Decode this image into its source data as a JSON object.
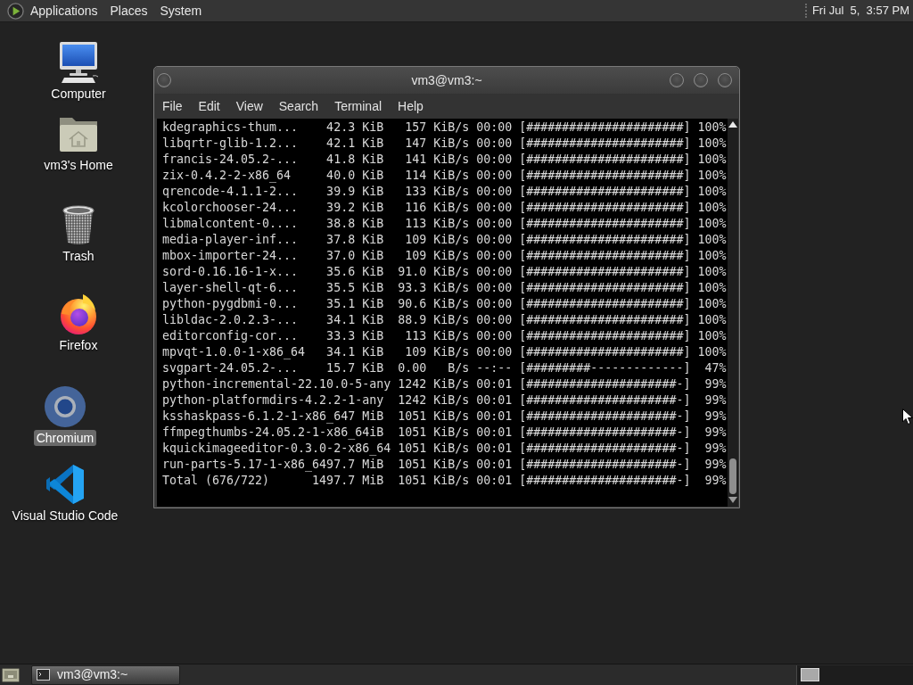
{
  "top_panel": {
    "menus": [
      "Applications",
      "Places",
      "System"
    ],
    "clock": "Fri Jul  5,  3:57 PM"
  },
  "desktop_icons": [
    {
      "label": "Computer",
      "kind": "computer",
      "selected": false
    },
    {
      "label": "vm3's Home",
      "kind": "home",
      "selected": false
    },
    {
      "label": "Trash",
      "kind": "trash",
      "selected": false
    },
    {
      "label": "Firefox",
      "kind": "firefox",
      "selected": false
    },
    {
      "label": "Chromium",
      "kind": "chromium",
      "selected": true
    },
    {
      "label": "Visual Studio Code",
      "kind": "vscode",
      "selected": false
    }
  ],
  "terminal_window": {
    "title": "vm3@vm3:~",
    "menu": [
      "File",
      "Edit",
      "View",
      "Search",
      "Terminal",
      "Help"
    ],
    "lines": [
      "kdegraphics-thum...    42.3 KiB   157 KiB/s 00:00 [######################] 100%",
      "libqrtr-glib-1.2...    42.1 KiB   147 KiB/s 00:00 [######################] 100%",
      "francis-24.05.2-...    41.8 KiB   141 KiB/s 00:00 [######################] 100%",
      "zix-0.4.2-2-x86_64     40.0 KiB   114 KiB/s 00:00 [######################] 100%",
      "qrencode-4.1.1-2...    39.9 KiB   133 KiB/s 00:00 [######################] 100%",
      "kcolorchooser-24...    39.2 KiB   116 KiB/s 00:00 [######################] 100%",
      "libmalcontent-0....    38.8 KiB   113 KiB/s 00:00 [######################] 100%",
      "media-player-inf...    37.8 KiB   109 KiB/s 00:00 [######################] 100%",
      "mbox-importer-24...    37.0 KiB   109 KiB/s 00:00 [######################] 100%",
      "sord-0.16.16-1-x...    35.6 KiB  91.0 KiB/s 00:00 [######################] 100%",
      "layer-shell-qt-6...    35.5 KiB  93.3 KiB/s 00:00 [######################] 100%",
      "python-pygdbmi-0...    35.1 KiB  90.6 KiB/s 00:00 [######################] 100%",
      "libldac-2.0.2.3-...    34.1 KiB  88.9 KiB/s 00:00 [######################] 100%",
      "editorconfig-cor...    33.3 KiB   113 KiB/s 00:00 [######################] 100%",
      "mpvqt-1.0.0-1-x86_64   34.1 KiB   109 KiB/s 00:00 [######################] 100%",
      "svgpart-24.05.2-...    15.7 KiB  0.00   B/s --:-- [#########-------------]  47%",
      "python-incremental-22.10.0-5-any 1242 KiB/s 00:01 [#####################-]  99%",
      "python-platformdirs-4.2.2-1-any  1242 KiB/s 00:01 [#####################-]  99%",
      "ksshaskpass-6.1.2-1-x86_647 MiB  1051 KiB/s 00:01 [#####################-]  99%",
      "ffmpegthumbs-24.05.2-1-x86_64iB  1051 KiB/s 00:01 [#####################-]  99%",
      "kquickimageeditor-0.3.0-2-x86_64 1051 KiB/s 00:01 [#####################-]  99%",
      "run-parts-5.17-1-x86_6497.7 MiB  1051 KiB/s 00:01 [#####################-]  99%",
      "Total (676/722)      1497.7 MiB  1051 KiB/s 00:01 [#####################-]  99%"
    ]
  },
  "taskbar": {
    "window_buttons": [
      {
        "label": "vm3@vm3:~"
      }
    ]
  }
}
